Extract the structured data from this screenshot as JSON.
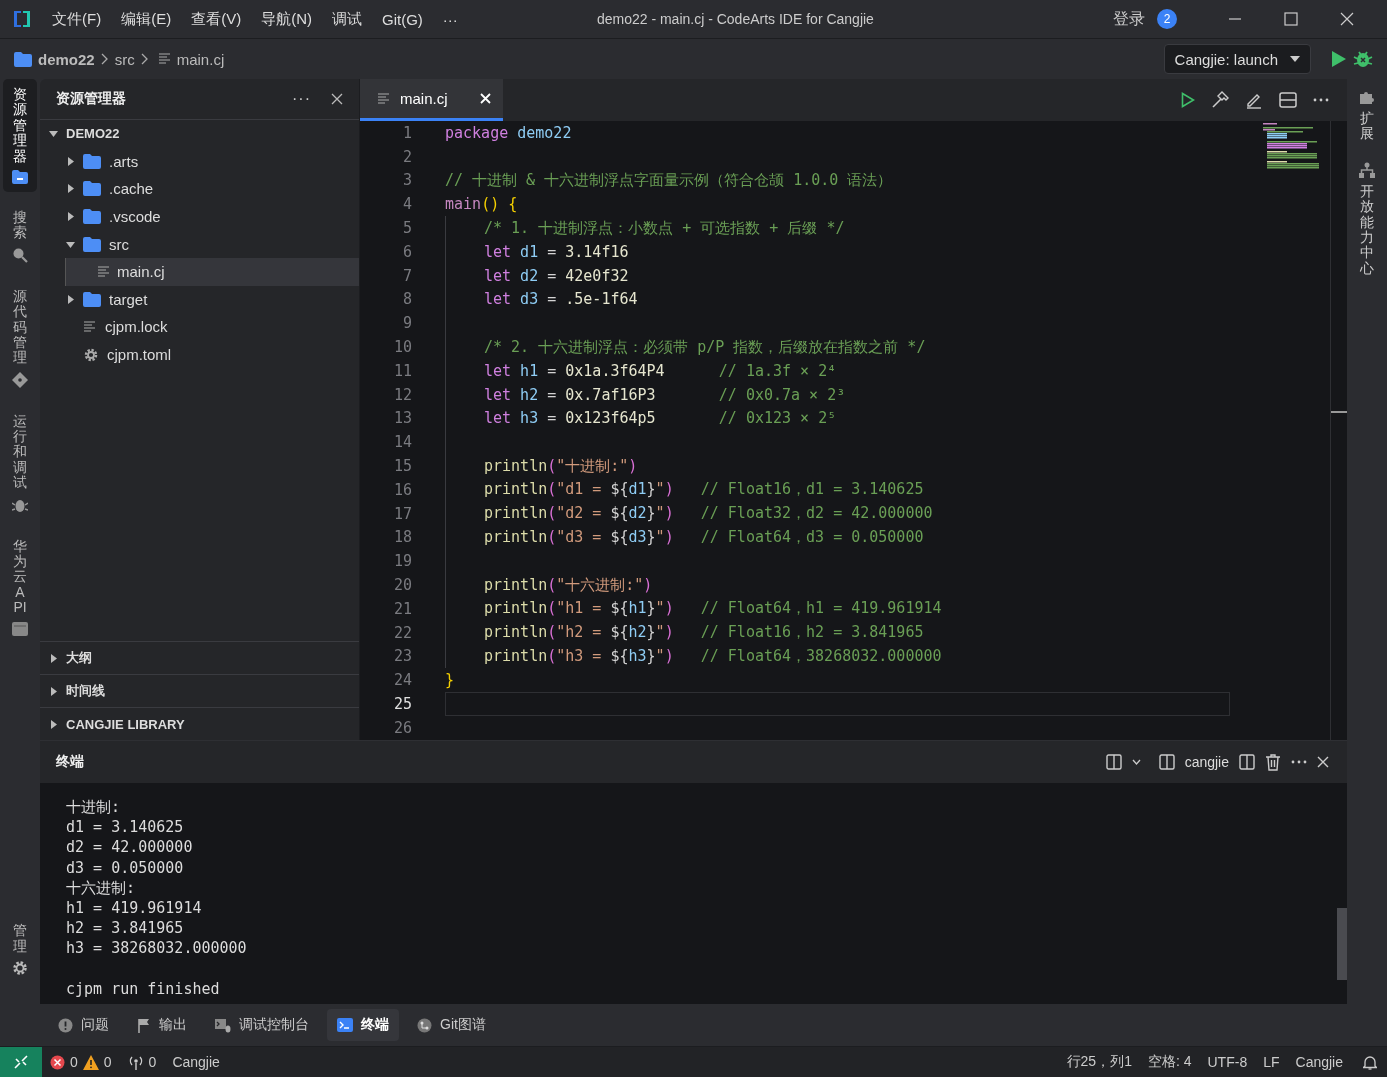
{
  "title_bar": {
    "menu": [
      "文件(F)",
      "编辑(E)",
      "查看(V)",
      "导航(N)",
      "调试",
      "Git(G)"
    ],
    "more": "···",
    "title": "demo22 - main.cj - CodeArts IDE for Cangjie",
    "login": "登录",
    "badge": "2"
  },
  "breadcrumb": [
    "demo22",
    "src",
    "main.cj"
  ],
  "run_config": "Cangjie: launch",
  "activity_bar": [
    {
      "label": "资源管理器",
      "kind": "explorer",
      "selected": true
    },
    {
      "label": "搜索",
      "kind": "search",
      "selected": false
    },
    {
      "label": "源代码管理",
      "kind": "scm",
      "selected": false
    },
    {
      "label": "运行和调试",
      "kind": "debug",
      "selected": false
    },
    {
      "label": "华为云 API",
      "kind": "api",
      "selected": false
    }
  ],
  "manage": {
    "label": "管理"
  },
  "right_bar": [
    {
      "label": "扩展",
      "kind": "extensions"
    },
    {
      "label": "开放能力中心",
      "kind": "hub"
    }
  ],
  "explorer": {
    "title": "资源管理器",
    "more": "···",
    "root": {
      "label": "DEMO22",
      "expanded": true
    },
    "tree": [
      {
        "label": ".arts",
        "kind": "folder",
        "expanded": false,
        "selected": false
      },
      {
        "label": ".cache",
        "kind": "folder",
        "expanded": false,
        "selected": false
      },
      {
        "label": ".vscode",
        "kind": "folder",
        "expanded": false,
        "selected": false
      },
      {
        "label": "src",
        "kind": "folder",
        "expanded": true,
        "selected": false,
        "children": [
          {
            "label": "main.cj",
            "kind": "file",
            "selected": true
          }
        ]
      },
      {
        "label": "target",
        "kind": "folder",
        "expanded": false,
        "selected": false
      },
      {
        "label": "cjpm.lock",
        "kind": "file",
        "selected": false
      },
      {
        "label": "cjpm.toml",
        "kind": "config",
        "selected": false
      }
    ],
    "sections": [
      {
        "label": "大纲",
        "expanded": false
      },
      {
        "label": "时间线",
        "expanded": false
      },
      {
        "label": "CANGJIE LIBRARY",
        "expanded": false
      }
    ]
  },
  "editor": {
    "tabs": [
      {
        "label": "main.cj",
        "selected": true
      }
    ],
    "lines": [
      {
        "n": "1",
        "indented": false,
        "current": false,
        "tokens": [
          {
            "kind": "kw",
            "text": "package"
          },
          {
            "kind": "var",
            "text": " demo22"
          }
        ]
      },
      {
        "n": "2",
        "indented": false,
        "current": false
      },
      {
        "n": "3",
        "indented": false,
        "current": false,
        "tokens": [
          {
            "kind": "cmt",
            "text": "// 十进制 & 十六进制浮点字面量示例（符合仓颉 1.0.0 语法）"
          }
        ]
      },
      {
        "n": "4",
        "indented": false,
        "current": false,
        "tokens": [
          {
            "kind": "main",
            "text": "main"
          },
          {
            "kind": "brace",
            "text": "()"
          },
          {
            "kind": "brace",
            "text": " {"
          }
        ]
      },
      {
        "n": "5",
        "indented": true,
        "current": false,
        "tokens": [
          {
            "kind": "cmt",
            "text": "/* 1. 十进制浮点：小数点 + 可选指数 + 后缀 */"
          }
        ]
      },
      {
        "n": "6",
        "indented": true,
        "current": false,
        "tokens": [
          {
            "kind": "kw",
            "text": "let"
          },
          {
            "kind": "var",
            "text": " d1"
          },
          {
            "kind": "pl",
            "text": " = "
          },
          {
            "kind": "num",
            "text": "3.14f16"
          }
        ]
      },
      {
        "n": "7",
        "indented": true,
        "current": false,
        "tokens": [
          {
            "kind": "kw",
            "text": "let"
          },
          {
            "kind": "var",
            "text": " d2"
          },
          {
            "kind": "pl",
            "text": " = "
          },
          {
            "kind": "num",
            "text": "42e0f32"
          }
        ]
      },
      {
        "n": "8",
        "indented": true,
        "current": false,
        "tokens": [
          {
            "kind": "kw",
            "text": "let"
          },
          {
            "kind": "var",
            "text": " d3"
          },
          {
            "kind": "pl",
            "text": " = "
          },
          {
            "kind": "num",
            "text": ".5e-1f64"
          }
        ]
      },
      {
        "n": "9",
        "indented": true,
        "current": false
      },
      {
        "n": "10",
        "indented": true,
        "current": false,
        "tokens": [
          {
            "kind": "cmt",
            "text": "/* 2. 十六进制浮点：必须带 p/P 指数，后缀放在指数之前 */"
          }
        ]
      },
      {
        "n": "11",
        "indented": true,
        "current": false,
        "tokens": [
          {
            "kind": "kw",
            "text": "let"
          },
          {
            "kind": "var",
            "text": " h1"
          },
          {
            "kind": "pl",
            "text": " = "
          },
          {
            "kind": "num",
            "text": "0x1a.3f64P4"
          },
          {
            "kind": "cmt",
            "text": "      // 1a.3f × 2⁴"
          }
        ]
      },
      {
        "n": "12",
        "indented": true,
        "current": false,
        "tokens": [
          {
            "kind": "kw",
            "text": "let"
          },
          {
            "kind": "var",
            "text": " h2"
          },
          {
            "kind": "pl",
            "text": " = "
          },
          {
            "kind": "num",
            "text": "0x.7af16P3"
          },
          {
            "kind": "cmt",
            "text": "       // 0x0.7a × 2³"
          }
        ]
      },
      {
        "n": "13",
        "indented": true,
        "current": false,
        "tokens": [
          {
            "kind": "kw",
            "text": "let"
          },
          {
            "kind": "var",
            "text": " h3"
          },
          {
            "kind": "pl",
            "text": " = "
          },
          {
            "kind": "num",
            "text": "0x123f64p5"
          },
          {
            "kind": "cmt",
            "text": "       // 0x123 × 2⁵"
          }
        ]
      },
      {
        "n": "14",
        "indented": true,
        "current": false
      },
      {
        "n": "15",
        "indented": true,
        "current": false,
        "tokens": [
          {
            "kind": "fn",
            "text": "println"
          },
          {
            "kind": "paren",
            "text": "("
          },
          {
            "kind": "str",
            "text": "\"十进制:\""
          },
          {
            "kind": "paren",
            "text": ")"
          }
        ]
      },
      {
        "n": "16",
        "indented": true,
        "current": false,
        "tokens": [
          {
            "kind": "fn",
            "text": "println"
          },
          {
            "kind": "paren",
            "text": "("
          },
          {
            "kind": "str",
            "text": "\"d1 = "
          },
          {
            "kind": "pl",
            "text": "${"
          },
          {
            "kind": "var",
            "text": "d1"
          },
          {
            "kind": "pl",
            "text": "}"
          },
          {
            "kind": "str",
            "text": "\""
          },
          {
            "kind": "paren",
            "text": ")"
          },
          {
            "kind": "cmt",
            "text": "   // Float16，d1 = 3.140625"
          }
        ]
      },
      {
        "n": "17",
        "indented": true,
        "current": false,
        "tokens": [
          {
            "kind": "fn",
            "text": "println"
          },
          {
            "kind": "paren",
            "text": "("
          },
          {
            "kind": "str",
            "text": "\"d2 = "
          },
          {
            "kind": "pl",
            "text": "${"
          },
          {
            "kind": "var",
            "text": "d2"
          },
          {
            "kind": "pl",
            "text": "}"
          },
          {
            "kind": "str",
            "text": "\""
          },
          {
            "kind": "paren",
            "text": ")"
          },
          {
            "kind": "cmt",
            "text": "   // Float32，d2 = 42.000000"
          }
        ]
      },
      {
        "n": "18",
        "indented": true,
        "current": false,
        "tokens": [
          {
            "kind": "fn",
            "text": "println"
          },
          {
            "kind": "paren",
            "text": "("
          },
          {
            "kind": "str",
            "text": "\"d3 = "
          },
          {
            "kind": "pl",
            "text": "${"
          },
          {
            "kind": "var",
            "text": "d3"
          },
          {
            "kind": "pl",
            "text": "}"
          },
          {
            "kind": "str",
            "text": "\""
          },
          {
            "kind": "paren",
            "text": ")"
          },
          {
            "kind": "cmt",
            "text": "   // Float64，d3 = 0.050000"
          }
        ]
      },
      {
        "n": "19",
        "indented": true,
        "current": false
      },
      {
        "n": "20",
        "indented": true,
        "current": false,
        "tokens": [
          {
            "kind": "fn",
            "text": "println"
          },
          {
            "kind": "paren",
            "text": "("
          },
          {
            "kind": "str",
            "text": "\"十六进制:\""
          },
          {
            "kind": "paren",
            "text": ")"
          }
        ]
      },
      {
        "n": "21",
        "indented": true,
        "current": false,
        "tokens": [
          {
            "kind": "fn",
            "text": "println"
          },
          {
            "kind": "paren",
            "text": "("
          },
          {
            "kind": "str",
            "text": "\"h1 = "
          },
          {
            "kind": "pl",
            "text": "${"
          },
          {
            "kind": "var",
            "text": "h1"
          },
          {
            "kind": "pl",
            "text": "}"
          },
          {
            "kind": "str",
            "text": "\""
          },
          {
            "kind": "paren",
            "text": ")"
          },
          {
            "kind": "cmt",
            "text": "   // Float64，h1 = 419.961914"
          }
        ]
      },
      {
        "n": "22",
        "indented": true,
        "current": false,
        "tokens": [
          {
            "kind": "fn",
            "text": "println"
          },
          {
            "kind": "paren",
            "text": "("
          },
          {
            "kind": "str",
            "text": "\"h2 = "
          },
          {
            "kind": "pl",
            "text": "${"
          },
          {
            "kind": "var",
            "text": "h2"
          },
          {
            "kind": "pl",
            "text": "}"
          },
          {
            "kind": "str",
            "text": "\""
          },
          {
            "kind": "paren",
            "text": ")"
          },
          {
            "kind": "cmt",
            "text": "   // Float16，h2 = 3.841965"
          }
        ]
      },
      {
        "n": "23",
        "indented": true,
        "current": false,
        "tokens": [
          {
            "kind": "fn",
            "text": "println"
          },
          {
            "kind": "paren",
            "text": "("
          },
          {
            "kind": "str",
            "text": "\"h3 = "
          },
          {
            "kind": "pl",
            "text": "${"
          },
          {
            "kind": "var",
            "text": "h3"
          },
          {
            "kind": "pl",
            "text": "}"
          },
          {
            "kind": "str",
            "text": "\""
          },
          {
            "kind": "paren",
            "text": ")"
          },
          {
            "kind": "cmt",
            "text": "   // Float64，38268032.000000"
          }
        ]
      },
      {
        "n": "24",
        "indented": false,
        "current": false,
        "tokens": [
          {
            "kind": "brace",
            "text": "}"
          }
        ]
      },
      {
        "n": "25",
        "indented": false,
        "current": true
      },
      {
        "n": "26",
        "indented": false,
        "current": false
      }
    ]
  },
  "panel": {
    "title": "终端",
    "terminal_name": "cangjie",
    "output": [
      [
        "十进制:",
        "d1 = 3.140625",
        "d2 = 42.000000",
        "d3 = 0.050000",
        "十六进制:",
        "h1 = 419.961914",
        "h2 = 3.841965",
        "h3 = 38268032.000000"
      ],
      [
        "cjpm run finished"
      ]
    ]
  },
  "panel_tabs": [
    {
      "label": "问题",
      "kind": "problems",
      "selected": false
    },
    {
      "label": "输出",
      "kind": "output",
      "selected": false
    },
    {
      "label": "调试控制台",
      "kind": "debug-console",
      "selected": false
    },
    {
      "label": "终端",
      "kind": "terminal",
      "selected": true
    },
    {
      "label": "Git图谱",
      "kind": "git",
      "selected": false
    }
  ],
  "status_bar": {
    "errors": "0",
    "warnings": "0",
    "ports": "0",
    "language": "Cangjie",
    "right": [
      "行25，列1",
      "空格: 4",
      "UTF-8",
      "LF",
      "Cangjie"
    ]
  }
}
